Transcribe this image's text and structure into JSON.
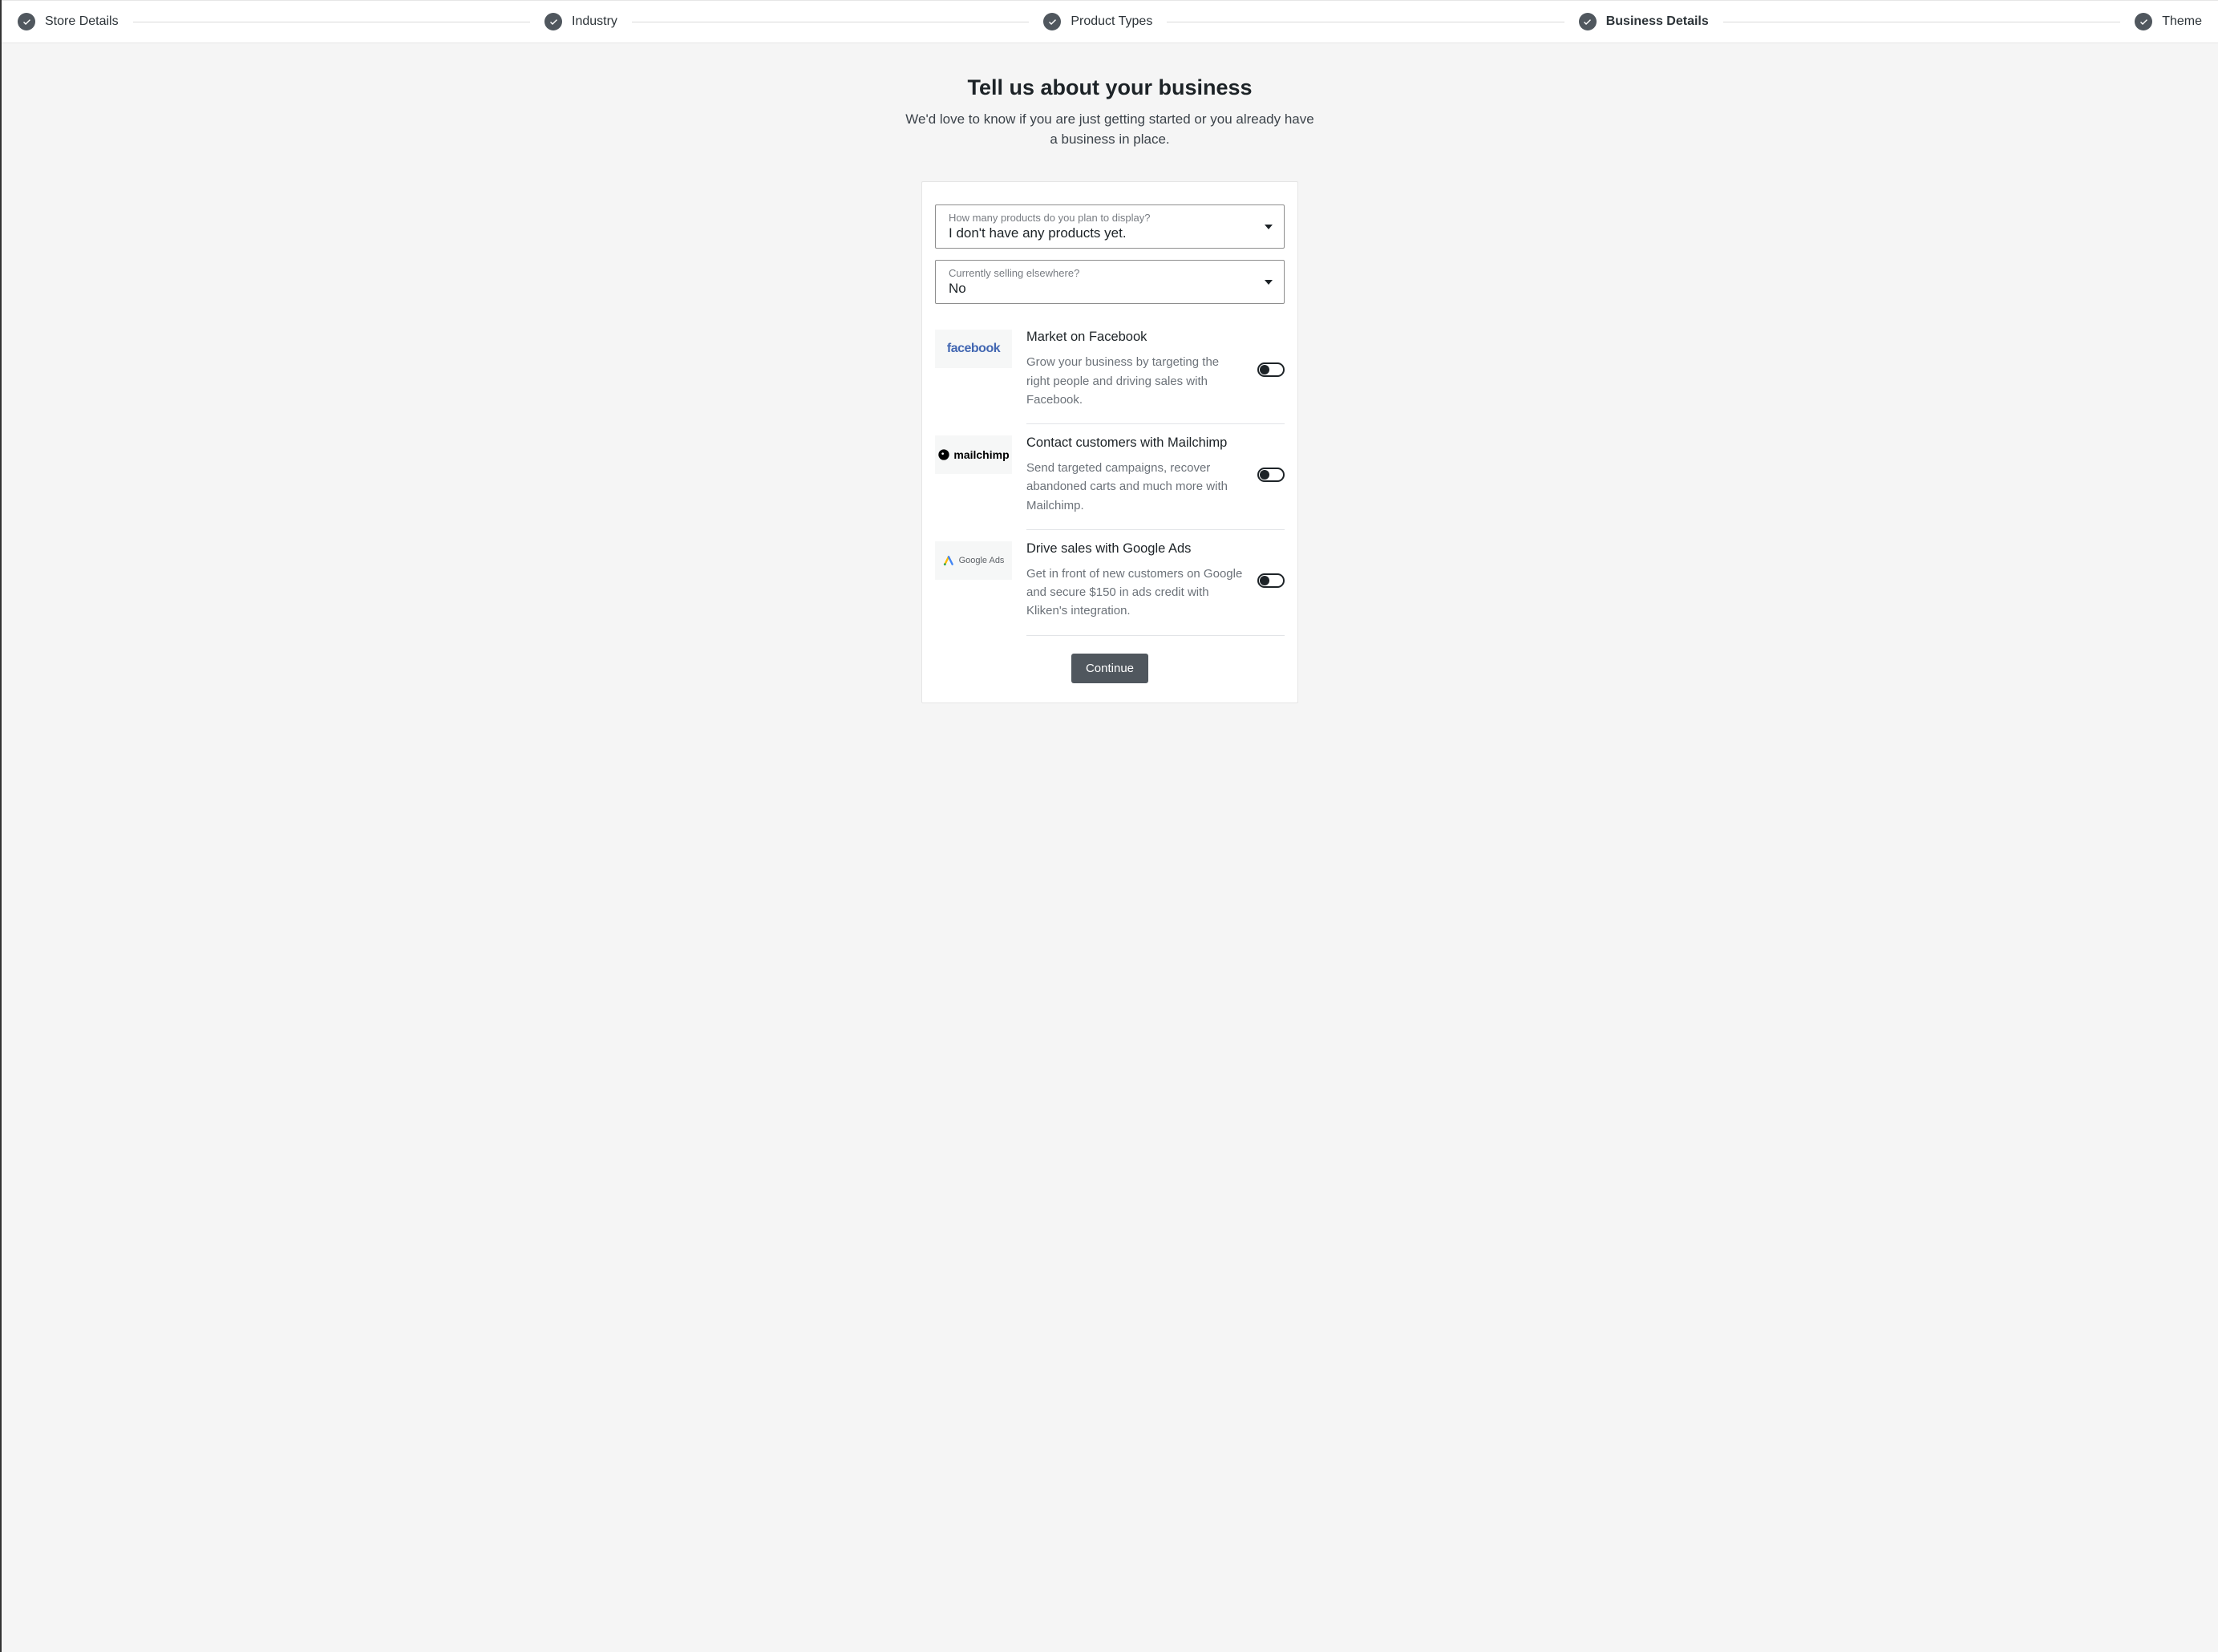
{
  "stepper": {
    "steps": [
      {
        "label": "Store Details",
        "done": true,
        "active": false
      },
      {
        "label": "Industry",
        "done": true,
        "active": false
      },
      {
        "label": "Product Types",
        "done": true,
        "active": false
      },
      {
        "label": "Business Details",
        "done": true,
        "active": true
      },
      {
        "label": "Theme",
        "done": true,
        "active": false
      }
    ]
  },
  "header": {
    "title": "Tell us about your business",
    "subtitle": "We'd love to know if you are just getting started or you already have a business in place."
  },
  "form": {
    "product_count": {
      "label": "How many products do you plan to display?",
      "value": "I don't have any products yet."
    },
    "selling_elsewhere": {
      "label": "Currently selling elsewhere?",
      "value": "No"
    }
  },
  "integrations": [
    {
      "id": "facebook",
      "logo_text": "facebook",
      "title": "Market on Facebook",
      "desc": "Grow your business by targeting the right people and driving sales with Facebook.",
      "enabled": false
    },
    {
      "id": "mailchimp",
      "logo_text": "mailchimp",
      "title": "Contact customers with Mailchimp",
      "desc": "Send targeted campaigns, recover abandoned carts and much more with Mailchimp.",
      "enabled": false
    },
    {
      "id": "googleads",
      "logo_text": "Google Ads",
      "title": "Drive sales with Google Ads",
      "desc": "Get in front of new customers on Google and secure $150 in ads credit with Kliken's integration.",
      "enabled": false
    }
  ],
  "actions": {
    "continue_label": "Continue"
  }
}
